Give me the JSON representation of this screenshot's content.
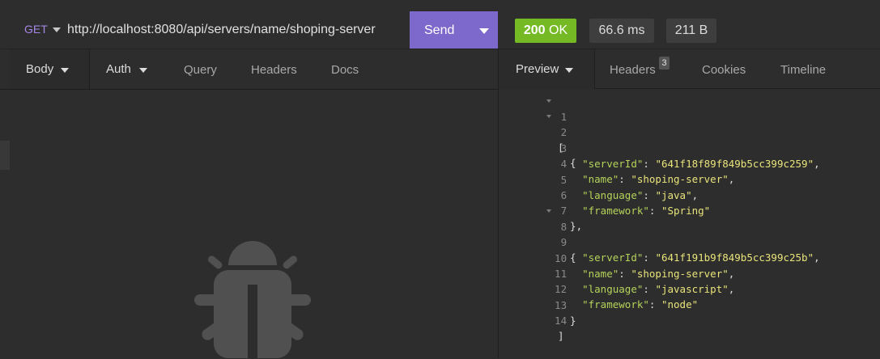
{
  "request": {
    "method": "GET",
    "url": "http://localhost:8080/api/servers/name/shoping-server",
    "send_label": "Send"
  },
  "response": {
    "status": "200 OK",
    "status_code": "200",
    "status_text": "OK",
    "time": "66.6 ms",
    "size": "211 B"
  },
  "left_tabs": [
    {
      "label": "Body"
    },
    {
      "label": "Auth"
    },
    {
      "label": "Query"
    },
    {
      "label": "Headers"
    },
    {
      "label": "Docs"
    }
  ],
  "right_tabs": [
    {
      "label": "Preview"
    },
    {
      "label": "Headers",
      "count": "3"
    },
    {
      "label": "Cookies"
    },
    {
      "label": "Timeline"
    }
  ],
  "code_lines": [
    {
      "n": "1"
    },
    {
      "n": "2"
    },
    {
      "n": "3"
    },
    {
      "n": "4"
    },
    {
      "n": "5"
    },
    {
      "n": "6"
    },
    {
      "n": "7"
    },
    {
      "n": "8"
    },
    {
      "n": "9"
    },
    {
      "n": "10"
    },
    {
      "n": "11"
    },
    {
      "n": "12"
    },
    {
      "n": "13"
    },
    {
      "n": "14"
    }
  ],
  "json_response": [
    {
      "serverId": "641f18f89f849b5cc399c259",
      "name": "shoping-server",
      "language": "java",
      "framework": "Spring"
    },
    {
      "serverId": "641f191b9f849b5cc399c25b",
      "name": "shoping-server",
      "language": "javascript",
      "framework": "node"
    }
  ],
  "colors": {
    "accent_send": "#7d69cb",
    "status_ok": "#75ba24",
    "json_key": "#b5d35a",
    "json_string": "#e9e47a",
    "method": "#a386e4"
  },
  "icons": {
    "empty_body": "bug-icon"
  }
}
